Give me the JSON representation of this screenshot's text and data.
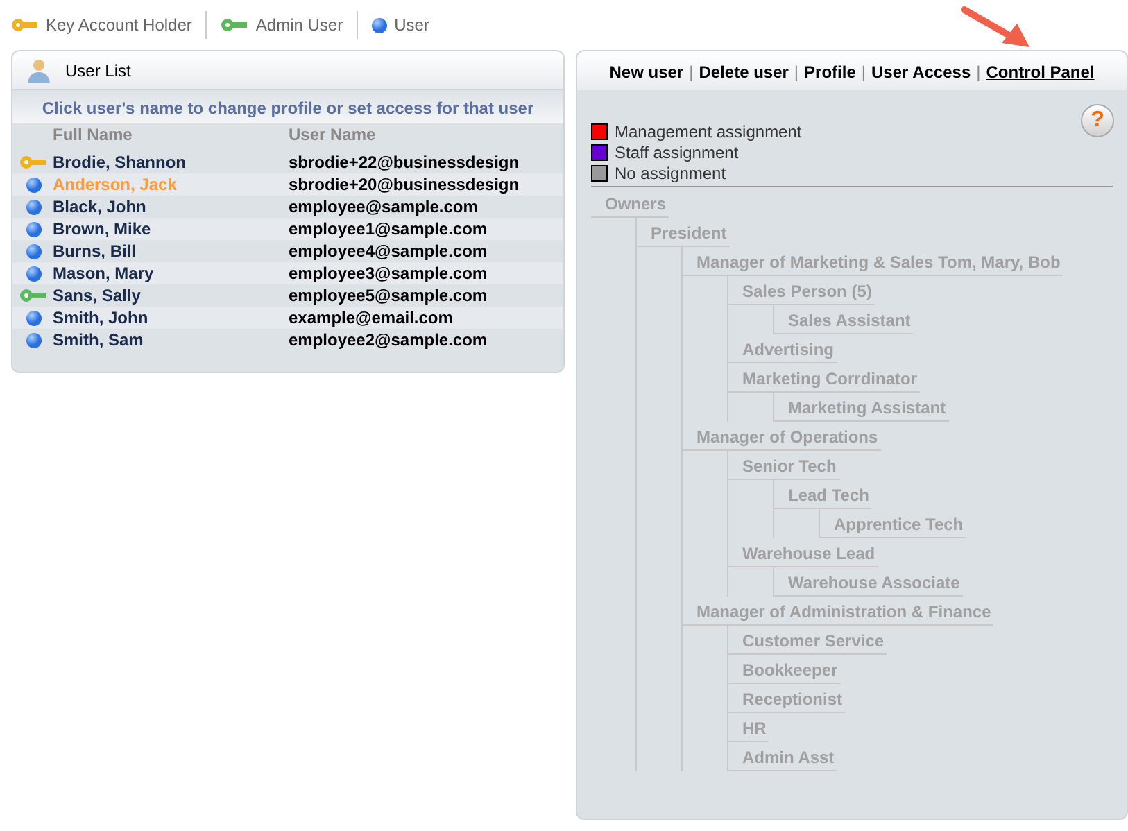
{
  "legend": [
    {
      "kind": "key",
      "label": "Key Account Holder"
    },
    {
      "kind": "admin",
      "label": "Admin User"
    },
    {
      "kind": "user",
      "label": "User"
    }
  ],
  "user_list": {
    "title": "User List",
    "hint": "Click user's name to change profile or set access for that user",
    "columns": [
      "Full Name",
      "User Name"
    ],
    "rows": [
      {
        "kind": "key",
        "name": "Brodie, Shannon",
        "username": "sbrodie+22@businessdesign",
        "selected": false
      },
      {
        "kind": "user",
        "name": "Anderson, Jack",
        "username": "sbrodie+20@businessdesign",
        "selected": true
      },
      {
        "kind": "user",
        "name": "Black, John",
        "username": "employee@sample.com",
        "selected": false
      },
      {
        "kind": "user",
        "name": "Brown, Mike",
        "username": "employee1@sample.com",
        "selected": false
      },
      {
        "kind": "user",
        "name": "Burns, Bill",
        "username": "employee4@sample.com",
        "selected": false
      },
      {
        "kind": "user",
        "name": "Mason, Mary",
        "username": "employee3@sample.com",
        "selected": false
      },
      {
        "kind": "admin",
        "name": "Sans, Sally",
        "username": "employee5@sample.com",
        "selected": false
      },
      {
        "kind": "user",
        "name": "Smith, John",
        "username": "example@email.com",
        "selected": false
      },
      {
        "kind": "user",
        "name": "Smith, Sam",
        "username": "employee2@sample.com",
        "selected": false
      }
    ]
  },
  "nav": [
    {
      "label": "New user",
      "selected": false
    },
    {
      "label": "Delete user",
      "selected": false
    },
    {
      "label": "Profile",
      "selected": false
    },
    {
      "label": "User Access",
      "selected": false
    },
    {
      "label": "Control Panel",
      "selected": true
    }
  ],
  "separator": "|",
  "help": "?",
  "assignment_legend": [
    {
      "label": "Management assignment",
      "color": "#ff0000"
    },
    {
      "label": "Staff assignment",
      "color": "#6600cc"
    },
    {
      "label": "No assignment",
      "color": "#999999"
    }
  ],
  "org_tree": [
    {
      "label": "Owners",
      "children": [
        {
          "label": "President",
          "children": [
            {
              "label": "Manager of Marketing & Sales Tom, Mary, Bob",
              "children": [
                {
                  "label": "Sales Person (5)",
                  "children": [
                    {
                      "label": "Sales Assistant"
                    }
                  ]
                },
                {
                  "label": "Advertising"
                },
                {
                  "label": "Marketing Corrdinator",
                  "children": [
                    {
                      "label": "Marketing Assistant"
                    }
                  ]
                }
              ]
            },
            {
              "label": "Manager of Operations",
              "children": [
                {
                  "label": "Senior Tech",
                  "children": [
                    {
                      "label": "Lead Tech",
                      "children": [
                        {
                          "label": "Apprentice Tech"
                        }
                      ]
                    }
                  ]
                },
                {
                  "label": "Warehouse Lead",
                  "children": [
                    {
                      "label": "Warehouse Associate"
                    }
                  ]
                }
              ]
            },
            {
              "label": "Manager of Administration & Finance",
              "children": [
                {
                  "label": "Customer Service"
                },
                {
                  "label": "Bookkeeper"
                },
                {
                  "label": "Receptionist"
                },
                {
                  "label": "HR"
                },
                {
                  "label": "Admin Asst"
                }
              ]
            }
          ]
        }
      ]
    }
  ]
}
